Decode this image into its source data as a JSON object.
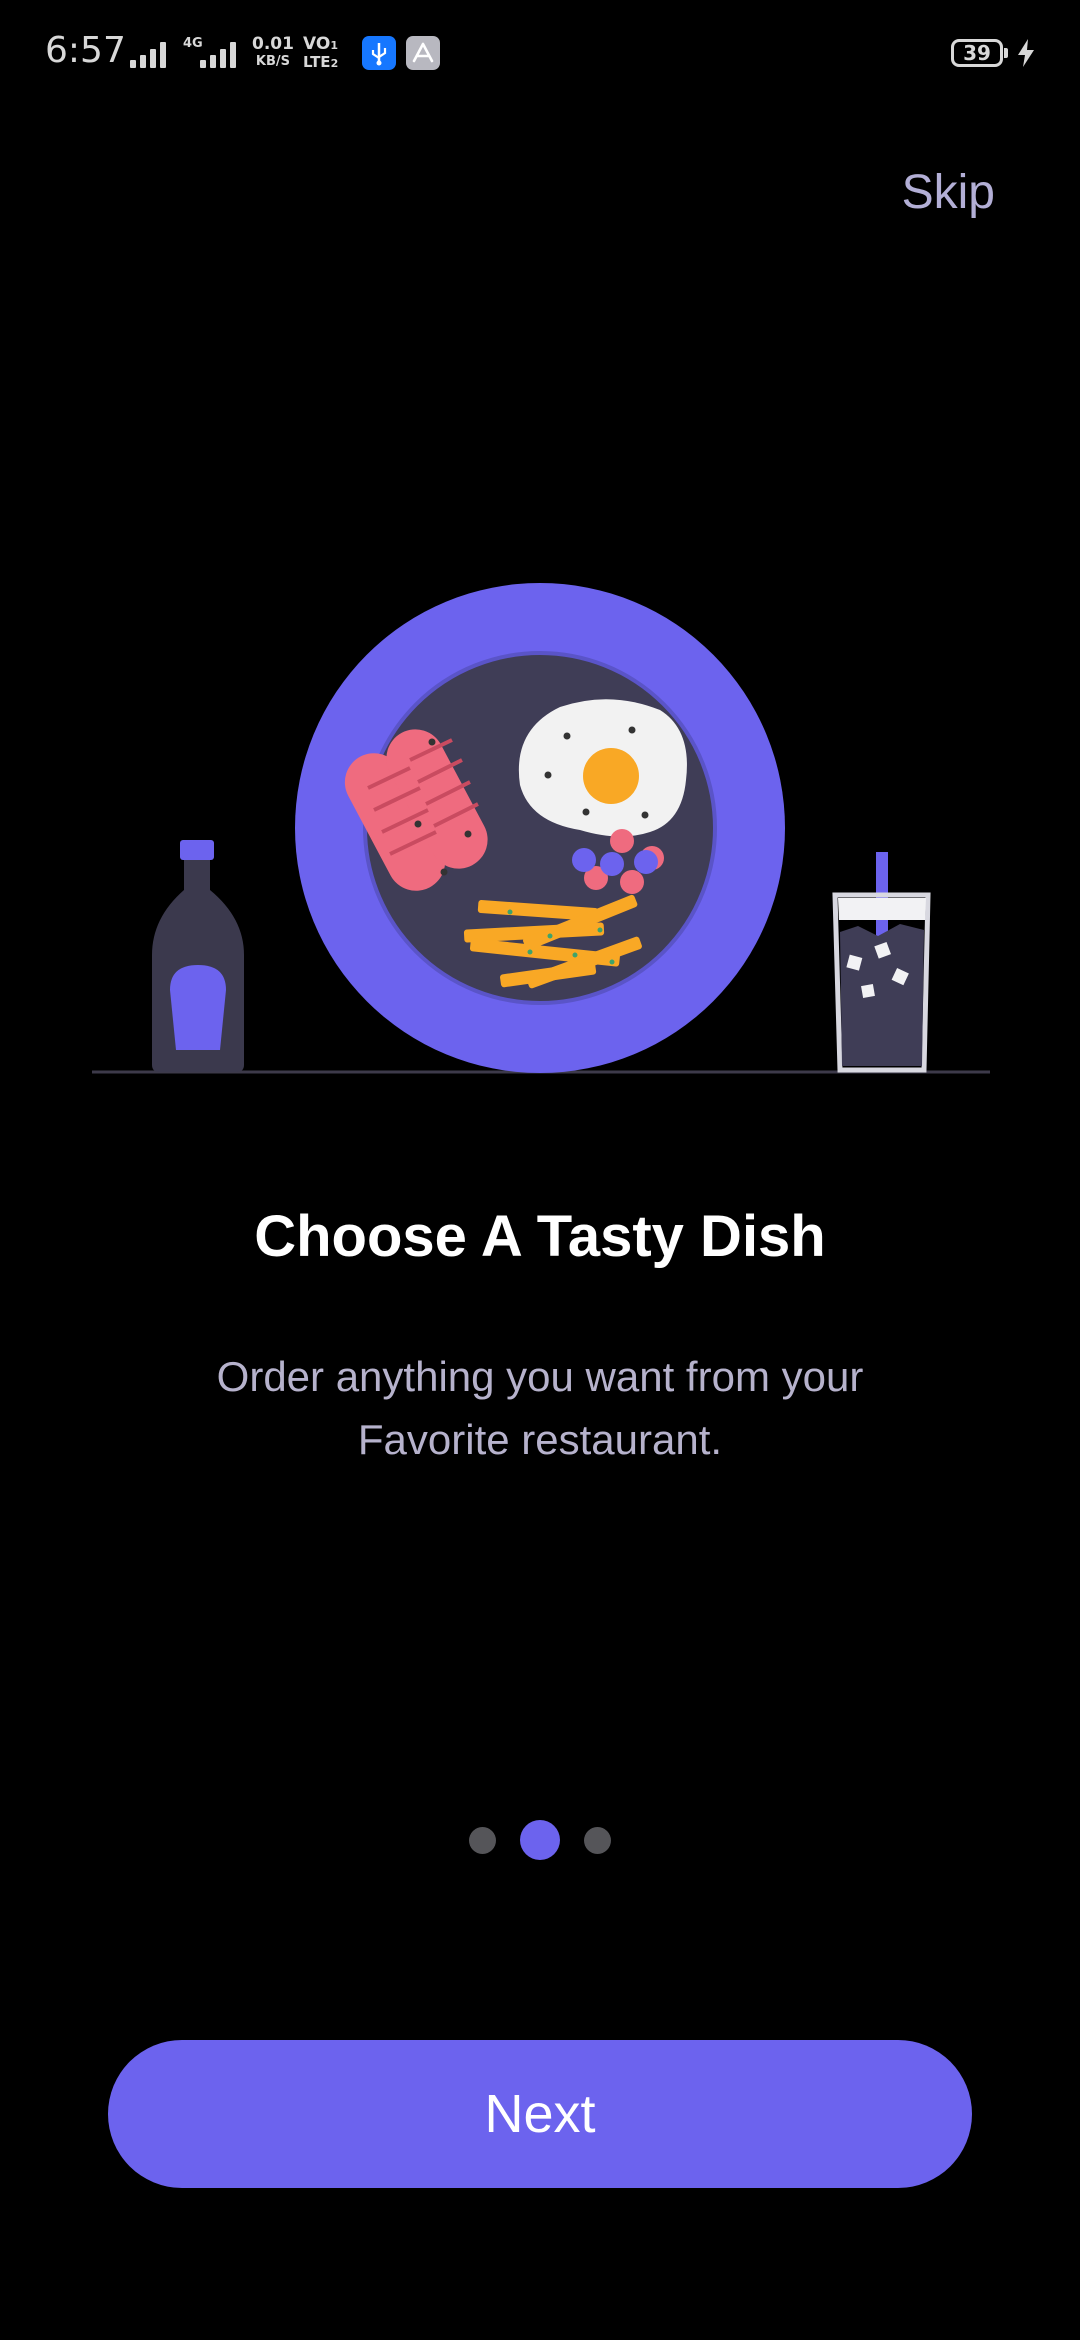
{
  "status_bar": {
    "time": "6:57",
    "network_type": "4G",
    "data_speed_value": "0.01",
    "data_speed_unit": "KB/S",
    "volte_top": "VO",
    "volte_bottom": "LTE",
    "sim1_tag": "1",
    "sim2_tag": "2",
    "battery_level": "39",
    "icons": [
      "signal-icon",
      "signal-4g-icon",
      "usb-debug-icon",
      "app-store-icon",
      "battery-icon",
      "charging-icon"
    ]
  },
  "onboarding": {
    "skip_label": "Skip",
    "title": "Choose A Tasty Dish",
    "subtitle": "Order anything you want from your Favorite restaurant.",
    "next_label": "Next",
    "page_count": 3,
    "current_page": 2
  },
  "colors": {
    "accent": "#6c63ee",
    "background": "#000000",
    "skip_text": "#b3afd6",
    "subtitle_text": "#b6b2cc",
    "inactive_dot": "#555559"
  }
}
